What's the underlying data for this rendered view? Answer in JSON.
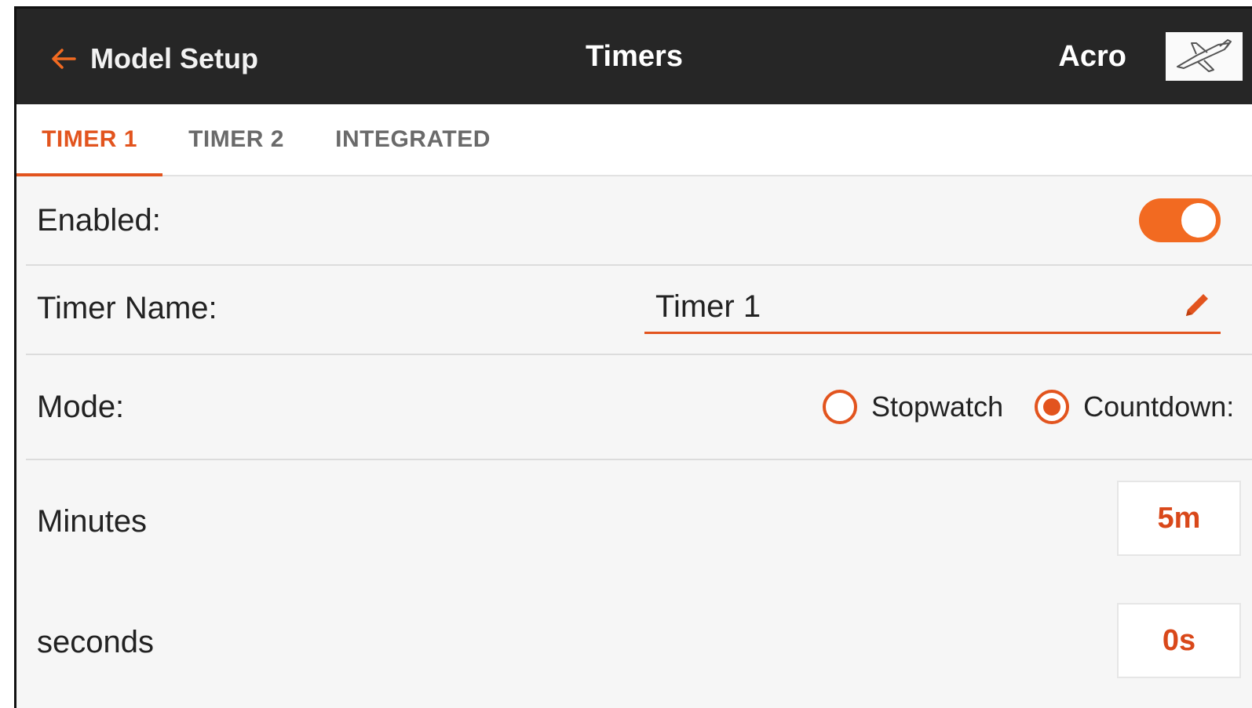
{
  "header": {
    "back_label": "Model Setup",
    "title": "Timers",
    "model_name": "Acro",
    "back_icon": "arrow-left-icon",
    "model_icon": "airplane-icon"
  },
  "tabs": [
    {
      "label": "TIMER 1",
      "active": true
    },
    {
      "label": "TIMER 2",
      "active": false
    },
    {
      "label": "INTEGRATED",
      "active": false
    }
  ],
  "settings": {
    "enabled": {
      "label": "Enabled:",
      "value": true
    },
    "timer_name": {
      "label": "Timer Name:",
      "value": "Timer 1",
      "icon": "pencil-icon"
    },
    "mode": {
      "label": "Mode:",
      "options": [
        {
          "label": "Stopwatch",
          "selected": false
        },
        {
          "label": "Countdown:",
          "selected": true
        }
      ]
    },
    "minutes": {
      "label": "Minutes",
      "value": "5m"
    },
    "seconds": {
      "label": "seconds",
      "value": "0s"
    }
  },
  "colors": {
    "accent": "#e2541e",
    "toggle_on": "#f26a21",
    "header_bg": "#262626",
    "content_bg": "#f6f6f6"
  }
}
